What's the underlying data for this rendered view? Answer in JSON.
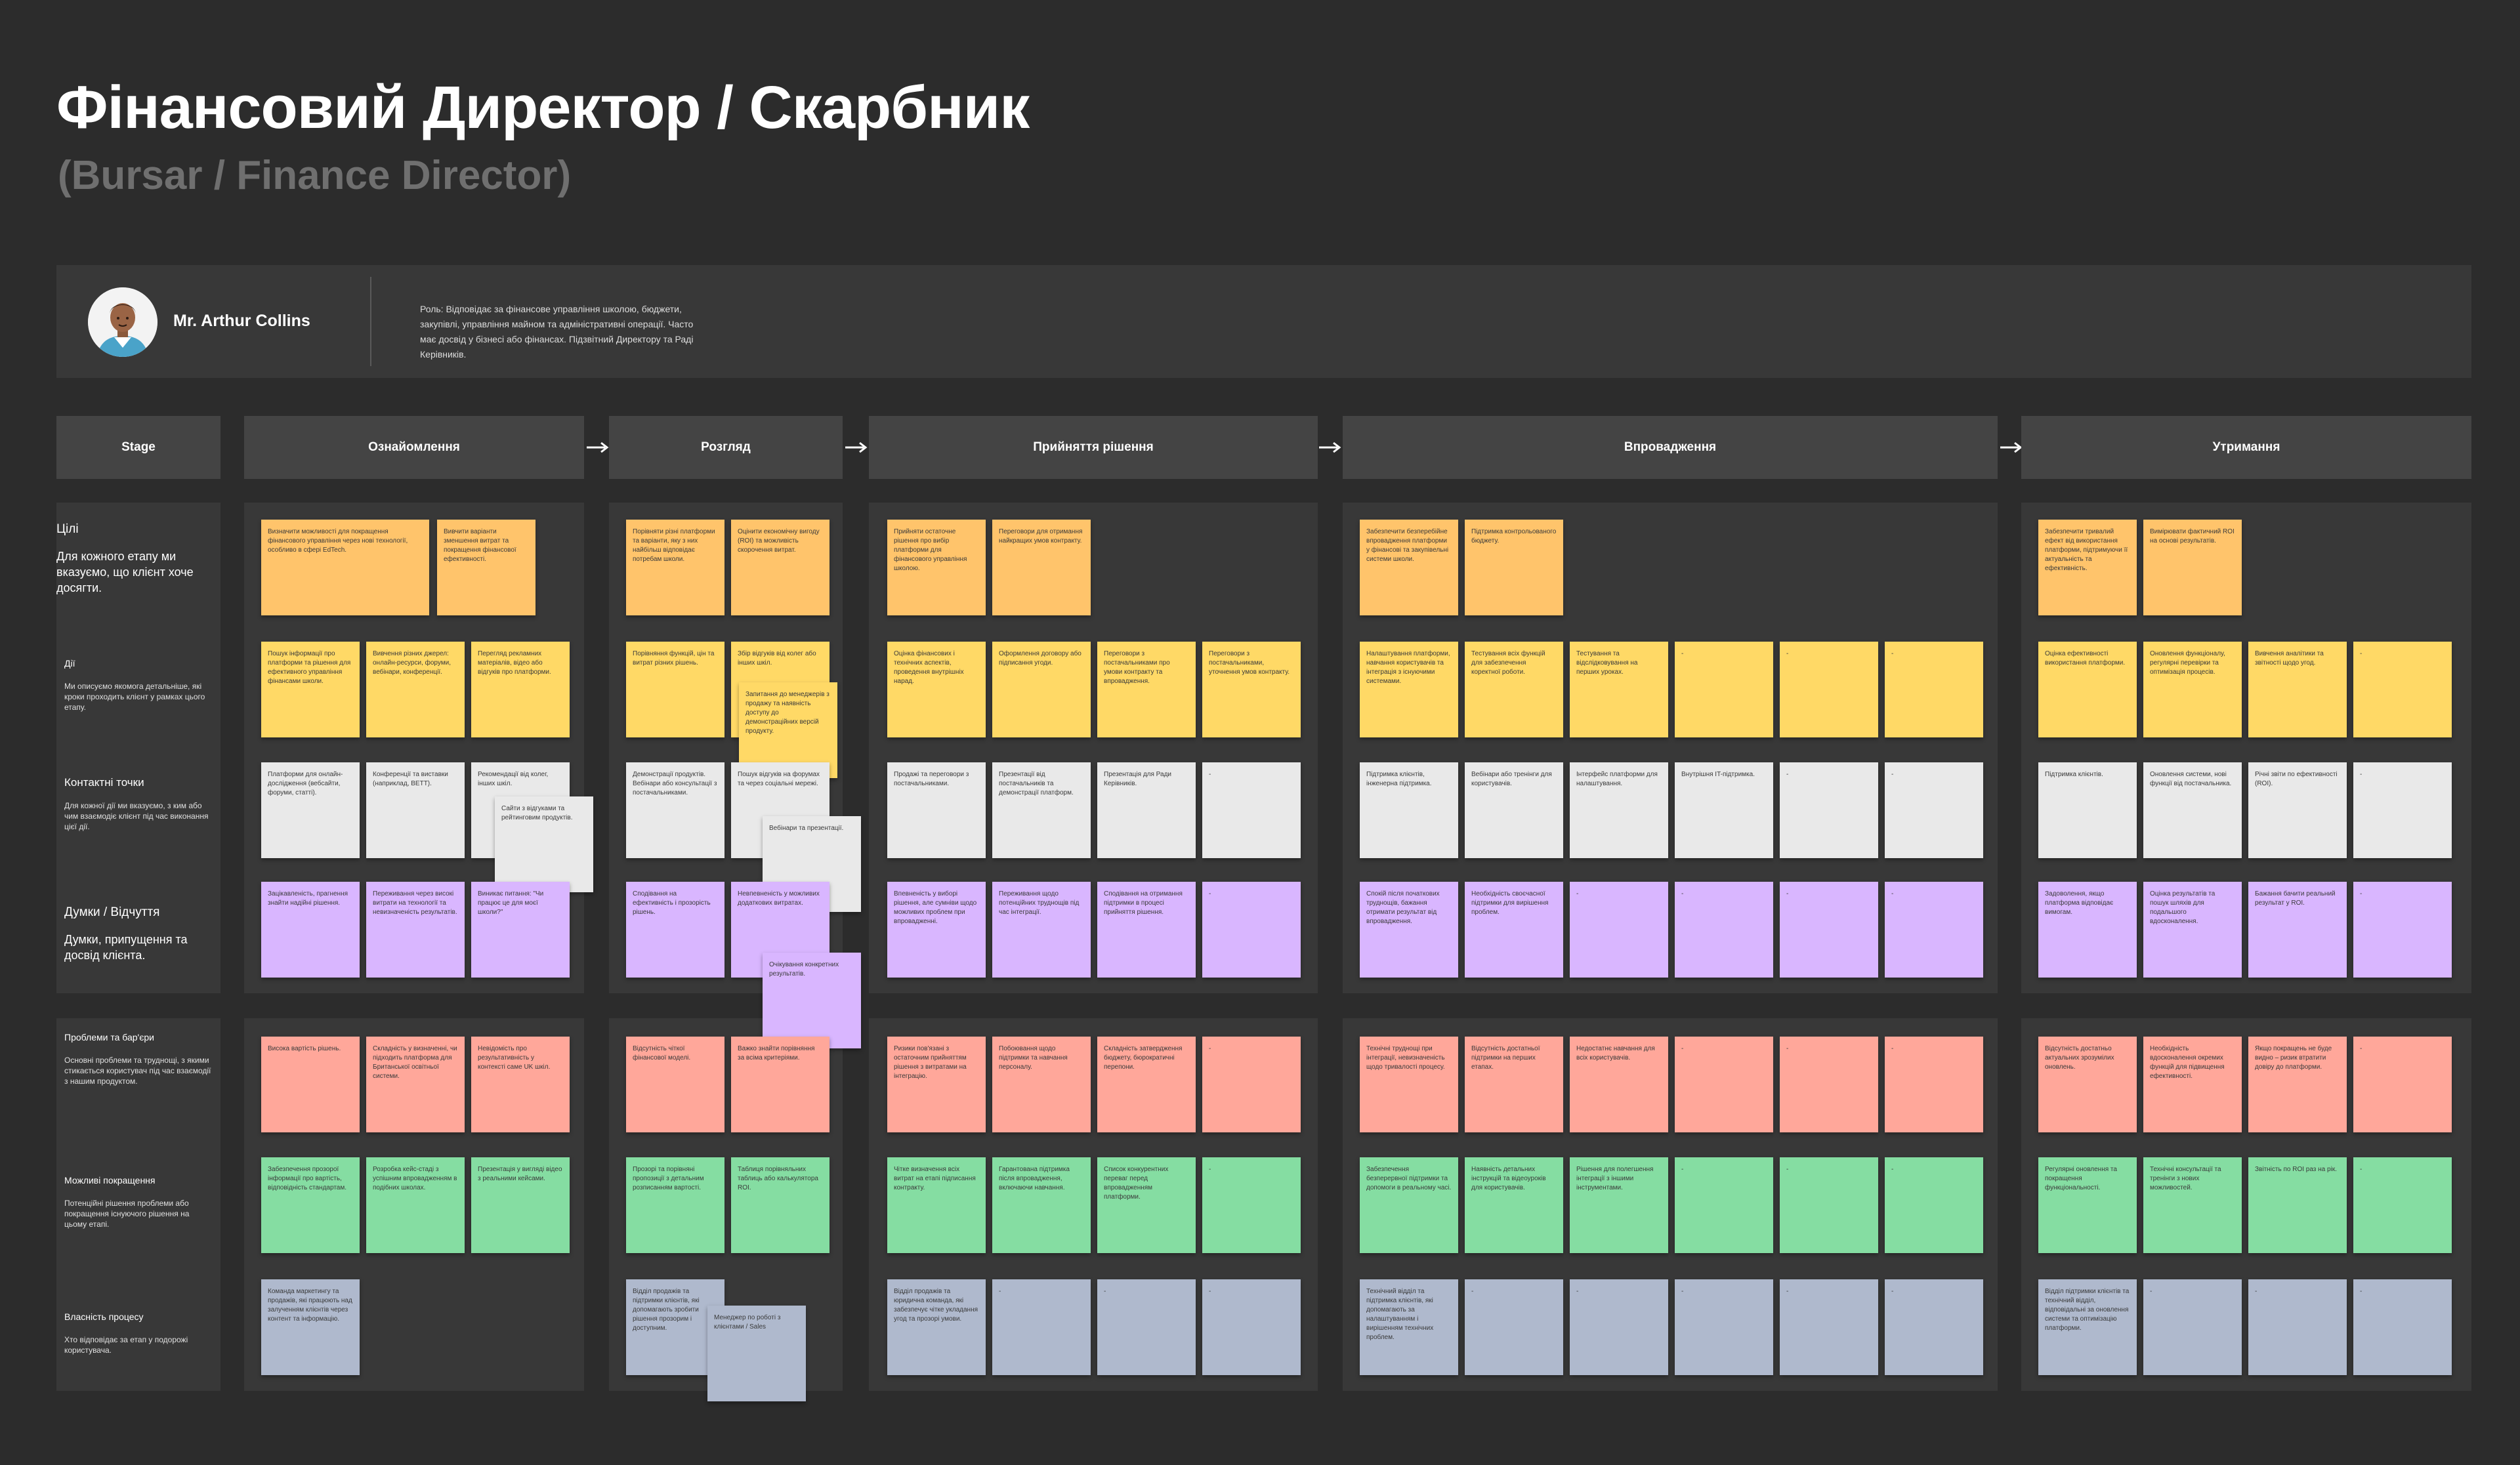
{
  "header": {
    "title": "Фінансовий Директор / Скарбник",
    "subtitle": "(Bursar / Finance Director)"
  },
  "persona": {
    "name": "Mr. Arthur Collins",
    "role": "Роль: Відповідає за фінансове управління школою, бюджети, закупівлі, управління майном та адміністративні операції. Часто має досвід у бізнесі або фінансах. Підзвітний Директору та Раді Керівників."
  },
  "stage_header": "Stage",
  "stages": [
    "Ознайомлення",
    "Розгляд",
    "Прийняття рішення",
    "Впровадження",
    "Утримання"
  ],
  "rows": [
    {
      "title": "Цілі",
      "desc": "Для кожного етапу ми вказуємо, що клієнт хоче досягти."
    },
    {
      "title": "Дії",
      "desc": "Ми описуємо якомога детальніше, які кроки проходить клієнт у рамках цього етапу."
    },
    {
      "title": "Контактні точки",
      "desc": "Для кожної дії ми вказуємо, з ким або чим взаємодіє клієнт під час виконання цієї дії."
    },
    {
      "title": "Думки / Відчуття",
      "desc": "Думки, припущення та досвід клієнта."
    },
    {
      "title": "Проблеми та бар'єри",
      "desc": "Основні проблеми та труднощі, з якими стикається користувач під час взаємодії з нашим продуктом."
    },
    {
      "title": "Можливі покращення",
      "desc": "Потенційні рішення проблеми або покращення існуючого рішення на цьому етапі."
    },
    {
      "title": "Власність процесу",
      "desc": "Хто відповідає за етап у подорожі користувача."
    }
  ],
  "notes": {
    "goals": {
      "s1": [
        "Визначити можливості для покращення фінансового управління через нові технології, особливо в сфері EdTech.",
        "Вивчити варіанти зменшення витрат та покращення фінансової ефективності."
      ],
      "s2": [
        "Порівняти різні платформи та варіанти, яку з них найбільш відповідає потребам школи.",
        "Оцінити економічну вигоду (ROI) та можливість скорочення витрат."
      ],
      "s3": [
        "Прийняти остаточне рішення про вибір платформи для фінансового управління школою.",
        "Переговори для отримання найкращих умов контракту."
      ],
      "s4": [
        "Забезпечити безперебійне впровадження платформи у фінансові та закупівельні системи школи.",
        "Підтримка контрольованого бюджету."
      ],
      "s5": [
        "Забезпечити тривалий ефект від використання платформи, підтримуючи її актуальність та ефективність.",
        "Вимірювати фактичний ROI на основі результатів."
      ]
    },
    "actions": {
      "s1": [
        "Пошук інформації про платформи та рішення для ефективного управління фінансами школи.",
        "Вивчення різних джерел: онлайн-ресурси, форуми, вебінари, конференції.",
        "Перегляд рекламних матеріалів, відео або відгуків про платформи."
      ],
      "s2": [
        "Порівняння функцій, цін та витрат різних рішень.",
        "Збір відгуків від колег або інших шкіл."
      ],
      "s2b": "Запитання до менеджерів з продажу та наявність доступу до демонстраційних версій продукту.",
      "s3": [
        "Оцінка фінансових і технічних аспектів, проведення внутрішніх нарад.",
        "Оформлення договору або підписання угоди.",
        "Переговори з постачальниками про умови контракту та впровадження.",
        "Переговори з постачальниками, уточнення умов контракту."
      ],
      "s4": [
        "Налаштування платформи, навчання користувачів та інтеграція з існуючими системами.",
        "Тестування всіх функцій для забезпечення коректної роботи.",
        "Тестування та відслідковування на перших уроках.",
        "-",
        "-",
        "-"
      ],
      "s5": [
        "Оцінка ефективності використання платформи.",
        "Оновлення функціоналу, регулярні перевірки та оптимізація процесів.",
        "Вивчення аналітики та звітності щодо угод.",
        "-"
      ]
    },
    "touchpoints": {
      "s1": [
        "Платформи для онлайн-дослідження (вебсайти, форуми, статті).",
        "Конференції та виставки (наприклад, BETT).",
        "Рекомендації від колег, інших шкіл."
      ],
      "s1b": "Сайти з відгуками та рейтинговим продуктів.",
      "s2": [
        "Демонстрації продуктів. Вебінари або консультації з постачальниками.",
        "Пошук відгуків на форумах та через соціальні мережі."
      ],
      "s2b": "Вебінари та презентації.",
      "s3": [
        "Продажі та переговори з постачальниками.",
        "Презентації від постачальників та демонстрації платформ.",
        "Презентація для Ради Керівників.",
        "-"
      ],
      "s4": [
        "Підтримка клієнтів, інженерна підтримка.",
        "Вебінари або тренінги для користувачів.",
        "Інтерфейс платформи для налаштування.",
        "Внутрішня IT-підтримка.",
        "-",
        "-"
      ],
      "s5": [
        "Підтримка клієнтів.",
        "Оновлення системи, нові функції від постачальника.",
        "Річні звіти по ефективності (ROI).",
        "-"
      ]
    },
    "thoughts": {
      "s1": [
        "Зацікавленість, прагнення знайти надійні рішення.",
        "Переживання через високі витрати на технології та невизначеність результатів.",
        "Виникає питання: \"Чи працює це для моєї школи?\""
      ],
      "s2": [
        "Сподівання на ефективність і прозорість рішень.",
        "Невпевненість у можливих додаткових витратах."
      ],
      "s2b": "Очікування конкретних результатів.",
      "s3": [
        "Впевненість у виборі рішення, але сумніви щодо можливих проблем при впровадженні.",
        "Переживання щодо потенційних труднощів під час інтеграції.",
        "Сподівання на отримання підтримки в процесі прийняття рішення.",
        "-"
      ],
      "s4": [
        "Спокій після початкових труднощів, бажання отримати результат від впровадження.",
        "Необхідність своєчасної підтримки для вирішення проблем.",
        "-",
        "-",
        "-",
        "-"
      ],
      "s5": [
        "Задоволення, якщо платформа відповідає вимогам.",
        "Оцінка результатів та пошук шляхів для подальшого вдосконалення.",
        "Бажання бачити реальний результат у ROI.",
        "-"
      ]
    },
    "problems": {
      "s1": [
        "Висока вартість рішень.",
        "Складність у визначенні, чи підходить платформа для Британської освітньої системи.",
        "Невідомість про результативність у контексті саме UK шкіл."
      ],
      "s2": [
        "Відсутність чіткої фінансової моделі.",
        "Важко знайти порівняння за всіма критеріями."
      ],
      "s3": [
        "Ризики пов'язані з остаточним прийняттям рішення з витратами на інтеграцію.",
        "Побоювання щодо підтримки та навчання персоналу.",
        "Складність затвердження бюджету, бюрократичні перепони.",
        "-"
      ],
      "s4": [
        "Технічні труднощі при інтеграції, невизначеність щодо тривалості процесу.",
        "Відсутність достатньої підтримки на перших етапах.",
        "Недостатнє навчання для всіх користувачів.",
        "-",
        "-",
        "-"
      ],
      "s5": [
        "Відсутність достатньо актуальних зрозумілих оновлень.",
        "Необхідність вдосконалення окремих функцій для підвищення ефективності.",
        "Якщо покращень не буде видно – ризик втратити довіру до платформи.",
        "-"
      ]
    },
    "improvements": {
      "s1": [
        "Забезпечення прозорої інформації про вартість, відповідність стандартам.",
        "Розробка кейс-стаді з успішним впровадженням в подібних школах.",
        "Презентація у вигляді відео з реальними кейсами."
      ],
      "s2": [
        "Прозорі та порівняні пропозиції з детальним розписанням вартості.",
        "Таблиця порівняльних таблиць або калькулятора ROI."
      ],
      "s3": [
        "Чітке визначення всіх витрат на етапі підписання контракту.",
        "Гарантована підтримка після впровадження, включаючи навчання.",
        "Список конкурентних переваг перед впровадженням платформи.",
        "-"
      ],
      "s4": [
        "Забезпечення безперервної підтримки та допомоги в реальному часі.",
        "Наявність детальних інструкцій та відеоуроків для користувачів.",
        "Рішення для полегшення інтеграції з іншими інструментами.",
        "-",
        "-",
        "-"
      ],
      "s5": [
        "Регулярні оновлення та покращення функціональності.",
        "Технічні консультації та тренінги з нових можливостей.",
        "Звітність по ROI раз на рік.",
        "-"
      ]
    },
    "ownership": {
      "s1": [
        "Команда маркетингу та продажів, які працюють над залученням клієнтів через контент та інформацію."
      ],
      "s2": [
        "Відділ продажів та підтримки клієнтів, які допомагають зробити рішення прозорим і доступним.",
        "Менеджер по роботі з клієнтами / Sales"
      ],
      "s3": [
        "Відділ продажів та юридична команда, які забезпечує чітке укладання угод та прозорі умови.",
        "-",
        "-",
        "-"
      ],
      "s4": [
        "Технічний відділ та підтримка клієнтів, які допомагають за налаштуванням і вирішенням технічних проблем.",
        "-",
        "-",
        "-",
        "-",
        "-"
      ],
      "s5": [
        "Відділ підтримки клієнтів та технічний відділ, відповідальні за оновлення системи та оптимізацію платформи.",
        "-",
        "-",
        "-"
      ]
    }
  },
  "colors": {
    "background": "#2c2c2c",
    "panel": "#383838",
    "header": "#444444",
    "goals": "#ffc46b",
    "actions": "#ffd966",
    "touchpoints": "#e9e9e9",
    "thoughts": "#d9b6ff",
    "problems": "#ffa79a",
    "improvements": "#85dda2",
    "ownership": "#afb9cd"
  },
  "icons": {
    "stage_arrow": "arrow-right-icon",
    "avatar": "person-avatar-icon"
  }
}
